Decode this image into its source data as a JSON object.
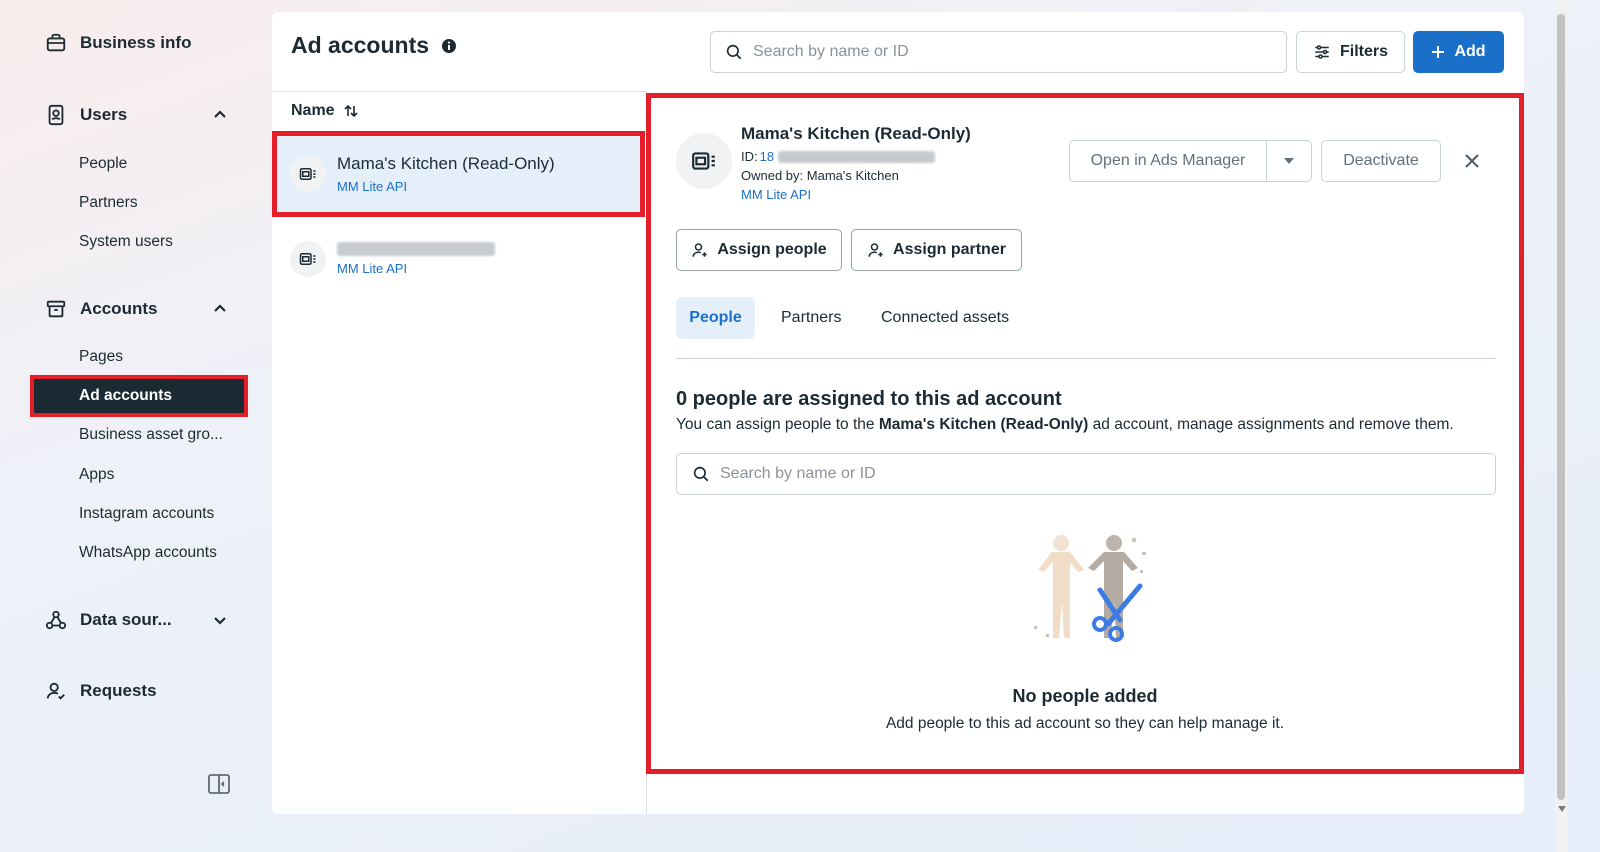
{
  "sidebar": {
    "business_info": "Business info",
    "users": {
      "label": "Users",
      "items": [
        "People",
        "Partners",
        "System users"
      ]
    },
    "accounts": {
      "label": "Accounts",
      "items": [
        "Pages",
        "Ad accounts",
        "Business asset gro...",
        "Apps",
        "Instagram accounts",
        "WhatsApp accounts"
      ]
    },
    "data_sources": "Data sour...",
    "requests": "Requests"
  },
  "header": {
    "title": "Ad accounts",
    "search_placeholder": "Search by name or ID",
    "filters_label": "Filters",
    "add_label": "Add"
  },
  "list": {
    "column_name": "Name",
    "items": [
      {
        "name": "Mama's Kitchen (Read-Only)",
        "sub": "MM Lite API"
      },
      {
        "name": "",
        "sub": "MM Lite API"
      }
    ]
  },
  "detail": {
    "name": "Mama's Kitchen (Read-Only)",
    "id_label": "ID:",
    "id_value": "18",
    "owned_by": "Owned by: Mama's Kitchen",
    "api": "MM Lite API",
    "open_ads_manager": "Open in Ads Manager",
    "deactivate": "Deactivate",
    "assign_people": "Assign people",
    "assign_partner": "Assign partner",
    "tabs": [
      "People",
      "Partners",
      "Connected assets"
    ],
    "assigned_title": "0 people are assigned to this ad account",
    "assigned_desc_pre": "You can assign people to the ",
    "assigned_desc_bold": "Mama's Kitchen (Read-Only)",
    "assigned_desc_post": " ad account, manage assignments and remove them.",
    "search_placeholder": "Search by name or ID",
    "empty_title": "No people added",
    "empty_desc": "Add people to this ad account so they can help manage it."
  },
  "colors": {
    "primary": "#1a70c9",
    "highlight": "#e41f2a",
    "dark": "#1c2b33"
  }
}
